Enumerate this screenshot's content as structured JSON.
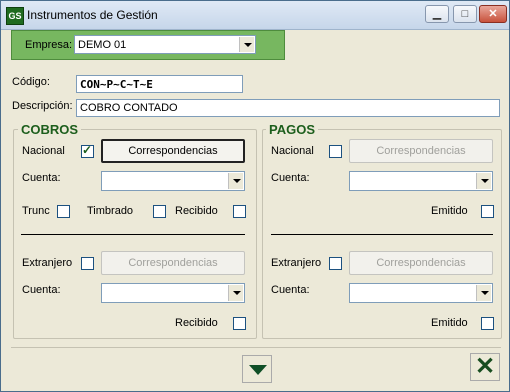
{
  "window": {
    "title": "Instrumentos de Gestión",
    "icon_text": "GS"
  },
  "empresa": {
    "label": "Empresa:",
    "value": "DEMO 01"
  },
  "codigo": {
    "label": "Código:",
    "value": "CON~P~C~T~E"
  },
  "descripcion": {
    "label": "Descripción:",
    "value": "COBRO CONTADO"
  },
  "cobros": {
    "title": "COBROS",
    "nacional_label": "Nacional",
    "nacional_checked": true,
    "correspondencias_label": "Correspondencias",
    "cuenta_label": "Cuenta:",
    "trunc_label": "Trunc",
    "timbrado_label": "Timbrado",
    "recibido_label": "Recibido",
    "extranjero_label": "Extranjero",
    "correspondencias2_label": "Correspondencias",
    "cuenta2_label": "Cuenta:",
    "recibido2_label": "Recibido"
  },
  "pagos": {
    "title": "PAGOS",
    "nacional_label": "Nacional",
    "correspondencias_label": "Correspondencias",
    "cuenta_label": "Cuenta:",
    "emitido_label": "Emitido",
    "extranjero_label": "Extranjero",
    "correspondencias2_label": "Correspondencias",
    "cuenta2_label": "Cuenta:",
    "emitido2_label": "Emitido"
  },
  "colors": {
    "accent_green": "#77b760",
    "group_title": "#1c5e1c"
  }
}
